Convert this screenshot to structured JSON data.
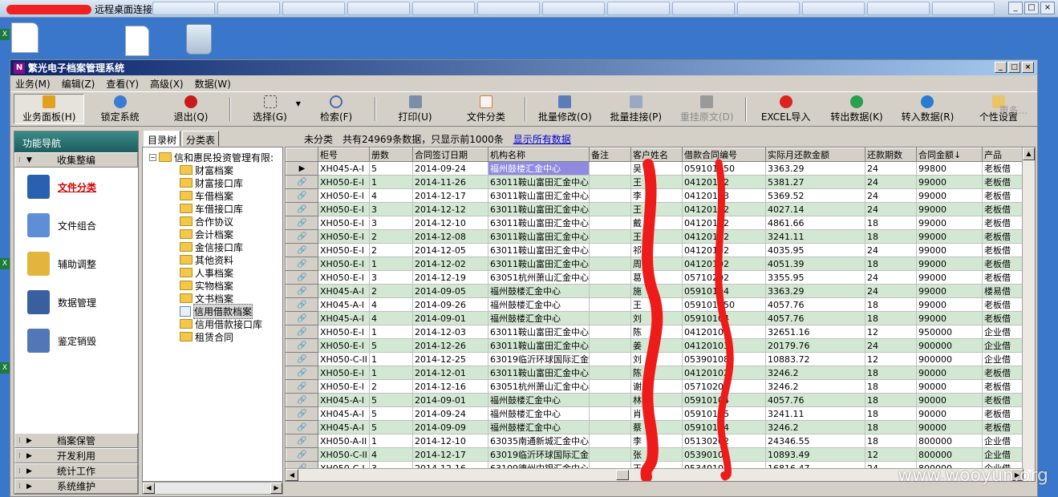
{
  "rdp": {
    "title": "远程桌面连接",
    "controls": [
      "_",
      "□",
      "×"
    ]
  },
  "app": {
    "title": "繁光电子档案管理系统",
    "window_controls": [
      "_",
      "□",
      "×"
    ]
  },
  "menu": [
    "业务(M)",
    "编辑(Z)",
    "查看(Y)",
    "高级(X)",
    "数据(W)"
  ],
  "toolbar": [
    {
      "label": "业务面板(H)",
      "icon": "folder-panel-icon",
      "state": "pressed"
    },
    {
      "label": "锁定系统",
      "icon": "person-lock-icon",
      "state": "normal"
    },
    {
      "label": "退出(Q)",
      "icon": "power-icon",
      "state": "normal"
    },
    {
      "label": "选择(G)",
      "icon": "select-cursor-icon",
      "state": "normal"
    },
    {
      "label": "检索(F)",
      "icon": "search-icon",
      "state": "normal"
    },
    {
      "label": "打印(U)",
      "icon": "printer-icon",
      "state": "normal"
    },
    {
      "label": "文件分类",
      "icon": "file-classify-icon",
      "state": "normal"
    },
    {
      "label": "批量修改(O)",
      "icon": "batch-edit-icon",
      "state": "normal"
    },
    {
      "label": "批量挂接(P)",
      "icon": "batch-attach-icon",
      "state": "normal"
    },
    {
      "label": "重挂原文(D)",
      "icon": "reattach-icon",
      "state": "disabled"
    },
    {
      "label": "EXCEL导入",
      "icon": "excel-import-icon",
      "state": "normal"
    },
    {
      "label": "转出数据(K)",
      "icon": "export-data-icon",
      "state": "normal"
    },
    {
      "label": "转入数据(R)",
      "icon": "import-data-icon",
      "state": "normal"
    },
    {
      "label": "个性设置",
      "icon": "personal-settings-icon",
      "state": "normal"
    }
  ],
  "toolbar_more": "更多...",
  "nav": {
    "header": "功能导航",
    "open_section": "收集整编",
    "items": [
      {
        "label": "文件分类",
        "icon": "document-icon",
        "active": true
      },
      {
        "label": "文件组合",
        "icon": "file-combine-icon",
        "active": false
      },
      {
        "label": "辅助调整",
        "icon": "folder-star-icon",
        "active": false
      },
      {
        "label": "数据管理",
        "icon": "database-icon",
        "active": false
      },
      {
        "label": "鉴定销毁",
        "icon": "appraise-icon",
        "active": false
      }
    ],
    "bottom_sections": [
      "档案保管",
      "开发利用",
      "统计工作",
      "系统维护"
    ]
  },
  "tree": {
    "tabs": [
      "目录树",
      "分类表"
    ],
    "root": "信和惠民投资管理有限:",
    "nodes": [
      "财富档案",
      "财富接口库",
      "车借档案",
      "车借接口库",
      "合作协议",
      "会计档案",
      "金信接口库",
      "其他资料",
      "人事档案",
      "实物档案",
      "文书档案",
      "信用借款档案",
      "信用借款接口库",
      "租赁合同"
    ],
    "selected": "信用借款档案"
  },
  "info": {
    "category": "未分类",
    "count": "共有24969条数据，只显示前1000条",
    "show_all": "显示所有数据"
  },
  "grid": {
    "columns": [
      "柜号",
      "册数",
      "合同签订日期",
      "机构名称",
      "备注",
      "客户姓名",
      "借款合同编号",
      "实际月还款金额",
      "还款期数",
      "合同金额↓",
      "产品"
    ],
    "rows": [
      [
        "XH045-A-I",
        "5",
        "2014-09-24",
        "福州鼓楼汇金中心",
        "",
        "吴",
        "059101050",
        "3363.29",
        "24",
        "99800",
        "老板借"
      ],
      [
        "XH050-E-I",
        "1",
        "2014-11-26",
        "63011鞍山富田汇金中心",
        "",
        "王",
        "04120102",
        "5381.27",
        "24",
        "99000",
        "老板借"
      ],
      [
        "XH050-E-I",
        "4",
        "2014-12-17",
        "63011鞍山富田汇金中心",
        "",
        "李",
        "04120103",
        "5369.52",
        "24",
        "99000",
        "老板借"
      ],
      [
        "XH050-E-I",
        "3",
        "2014-12-12",
        "63011鞍山富田汇金中心",
        "",
        "王",
        "04120102",
        "4027.14",
        "24",
        "99000",
        "老板借"
      ],
      [
        "XH050-E-I",
        "3",
        "2014-12-10",
        "63011鞍山富田汇金中心",
        "",
        "戴",
        "04120102",
        "4861.66",
        "18",
        "99000",
        "老板借"
      ],
      [
        "XH050-E-I",
        "2",
        "2014-12-08",
        "63011鞍山富田汇金中心",
        "",
        "王",
        "04120102",
        "3241.11",
        "18",
        "99000",
        "老板借"
      ],
      [
        "XH050-E-I",
        "2",
        "2014-12-05",
        "63011鞍山富田汇金中心",
        "",
        "祁",
        "04120102",
        "4035.95",
        "24",
        "99000",
        "老板借"
      ],
      [
        "XH050-E-I",
        "1",
        "2014-12-02",
        "63011鞍山富田汇金中心",
        "",
        "周",
        "04120102",
        "4051.39",
        "18",
        "99000",
        "老板借"
      ],
      [
        "XH050-E-I",
        "3",
        "2014-12-19",
        "63051杭州萧山汇金中心",
        "",
        "葛",
        "05710202",
        "3355.95",
        "24",
        "99000",
        "老板借"
      ],
      [
        "XH045-A-I",
        "2",
        "2014-09-05",
        "福州鼓楼汇金中心",
        "",
        "施",
        "05910104",
        "3363.29",
        "24",
        "99000",
        "楼易借"
      ],
      [
        "XH045-A-I",
        "4",
        "2014-09-26",
        "福州鼓楼汇金中心",
        "",
        "王",
        "059101050",
        "4057.76",
        "18",
        "99000",
        "老板借"
      ],
      [
        "XH045-A-I",
        "4",
        "2014-09-01",
        "福州鼓楼汇金中心",
        "",
        "刘",
        "05910104",
        "4057.76",
        "18",
        "99000",
        "老板借"
      ],
      [
        "XH050-E-I",
        "1",
        "2014-12-03",
        "63011鞍山富田汇金中心",
        "",
        "陈",
        "04120102",
        "32651.16",
        "12",
        "950000",
        "企业借"
      ],
      [
        "XH050-E-I",
        "5",
        "2014-12-26",
        "63011鞍山富田汇金中心",
        "",
        "姜",
        "04120103",
        "20179.76",
        "24",
        "900000",
        "企业借"
      ],
      [
        "XH050-C-II",
        "1",
        "2014-12-25",
        "63019临沂环球国际汇金",
        "",
        "刘",
        "05390108",
        "10883.72",
        "12",
        "900000",
        "企业借"
      ],
      [
        "XH050-E-I",
        "1",
        "2014-12-01",
        "63011鞍山富田汇金中心",
        "",
        "陈",
        "04120102",
        "3246.2",
        "18",
        "90000",
        "老板借"
      ],
      [
        "XH050-E-I",
        "2",
        "2014-12-16",
        "63051杭州萧山汇金中心",
        "",
        "谢",
        "05710202",
        "3246.2",
        "18",
        "90000",
        "老板借"
      ],
      [
        "XH045-A-I",
        "5",
        "2014-09-01",
        "福州鼓楼汇金中心",
        "",
        "林",
        "05910104",
        "4057.76",
        "18",
        "90000",
        "老板借"
      ],
      [
        "XH045-A-I",
        "5",
        "2014-09-24",
        "福州鼓楼汇金中心",
        "",
        "肖",
        "05910105",
        "3241.11",
        "18",
        "90000",
        "老板借"
      ],
      [
        "XH045-A-I",
        "5",
        "2014-09-09",
        "福州鼓楼汇金中心",
        "",
        "蔡",
        "05910104",
        "3246.2",
        "18",
        "90000",
        "老板借"
      ],
      [
        "XH050-A-II",
        "1",
        "2014-12-10",
        "63035南通新城汇金中心",
        "",
        "李",
        "05130202",
        "24346.55",
        "18",
        "800000",
        "企业借"
      ],
      [
        "XH050-C-II",
        "4",
        "2014-12-17",
        "63019临沂环球国际汇金",
        "",
        "张",
        "05390105",
        "10893.49",
        "12",
        "800000",
        "企业借"
      ],
      [
        "XH050-C-I",
        "3",
        "2014-12-16",
        "63109德州中银汇金中心",
        "",
        "王",
        "05340101",
        "16816.47",
        "24",
        "800000",
        "企业借"
      ]
    ]
  },
  "watermark": "www.wooyun.org"
}
